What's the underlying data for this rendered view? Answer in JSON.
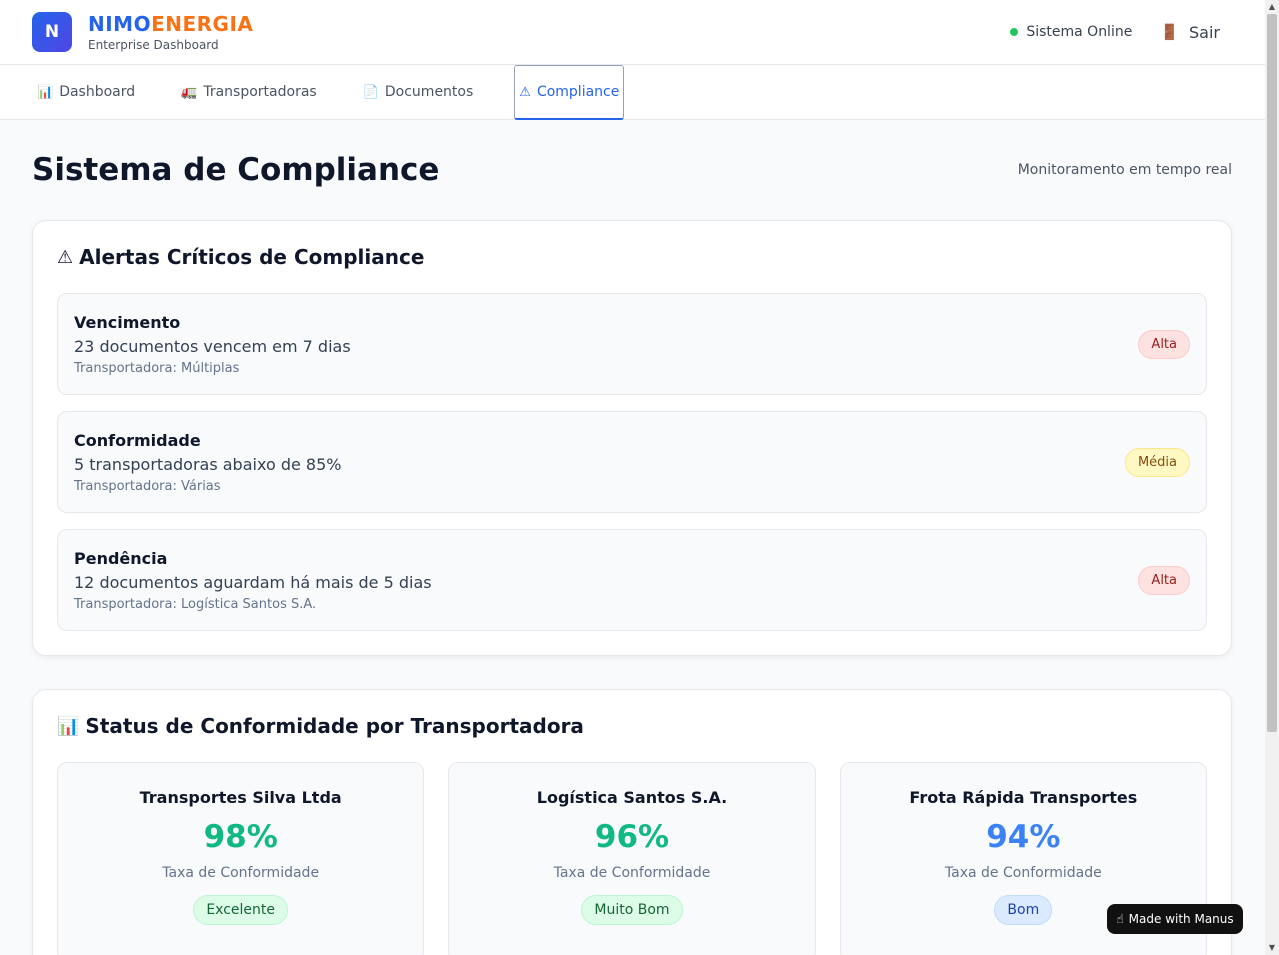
{
  "header": {
    "logo_letter": "N",
    "brand_part1": "NIMO",
    "brand_part2": "ENERGIA",
    "brand_subtitle": "Enterprise Dashboard",
    "status_text": "Sistema Online",
    "logout_label": "Sair",
    "logout_icon": "🚪"
  },
  "nav": {
    "tabs": [
      {
        "icon": "📊",
        "label": "Dashboard",
        "active": false
      },
      {
        "icon": "🚛",
        "label": "Transportadoras",
        "active": false
      },
      {
        "icon": "📄",
        "label": "Documentos",
        "active": false
      },
      {
        "icon": "⚠",
        "label": "Compliance",
        "active": true
      }
    ]
  },
  "page": {
    "title": "Sistema de Compliance",
    "subtitle": "Monitoramento em tempo real"
  },
  "alerts": {
    "icon": "⚠",
    "title": "Alertas Críticos de Compliance",
    "items": [
      {
        "type": "Vencimento",
        "message": "23 documentos vencem em 7 dias",
        "carrier": "Transportadora: Múltiplas",
        "priority": "Alta"
      },
      {
        "type": "Conformidade",
        "message": "5 transportadoras abaixo de 85%",
        "carrier": "Transportadora: Várias",
        "priority": "Média"
      },
      {
        "type": "Pendência",
        "message": "12 documentos aguardam há mais de 5 dias",
        "carrier": "Transportadora: Logística Santos S.A.",
        "priority": "Alta"
      }
    ]
  },
  "status": {
    "icon": "📊",
    "title": "Status de Conformidade por Transportadora",
    "carriers": [
      {
        "name": "Transportes Silva Ltda",
        "rate": "98%",
        "label": "Taxa de Conformidade",
        "rating": "Excelente",
        "rate_color": "#10b981",
        "rating_bg": "#dcfce7",
        "rating_fg": "#166534",
        "rating_border": "#bbf7d0"
      },
      {
        "name": "Logística Santos S.A.",
        "rate": "96%",
        "label": "Taxa de Conformidade",
        "rating": "Muito Bom",
        "rate_color": "#10b981",
        "rating_bg": "#dcfce7",
        "rating_fg": "#166534",
        "rating_border": "#bbf7d0"
      },
      {
        "name": "Frota Rápida Transportes",
        "rate": "94%",
        "label": "Taxa de Conformidade",
        "rating": "Bom",
        "rate_color": "#3b82f6",
        "rating_bg": "#dbeafe",
        "rating_fg": "#1e40af",
        "rating_border": "#bfdbfe"
      }
    ]
  },
  "made_with": {
    "label": "Made with Manus",
    "icon": "manus-hand-icon"
  }
}
